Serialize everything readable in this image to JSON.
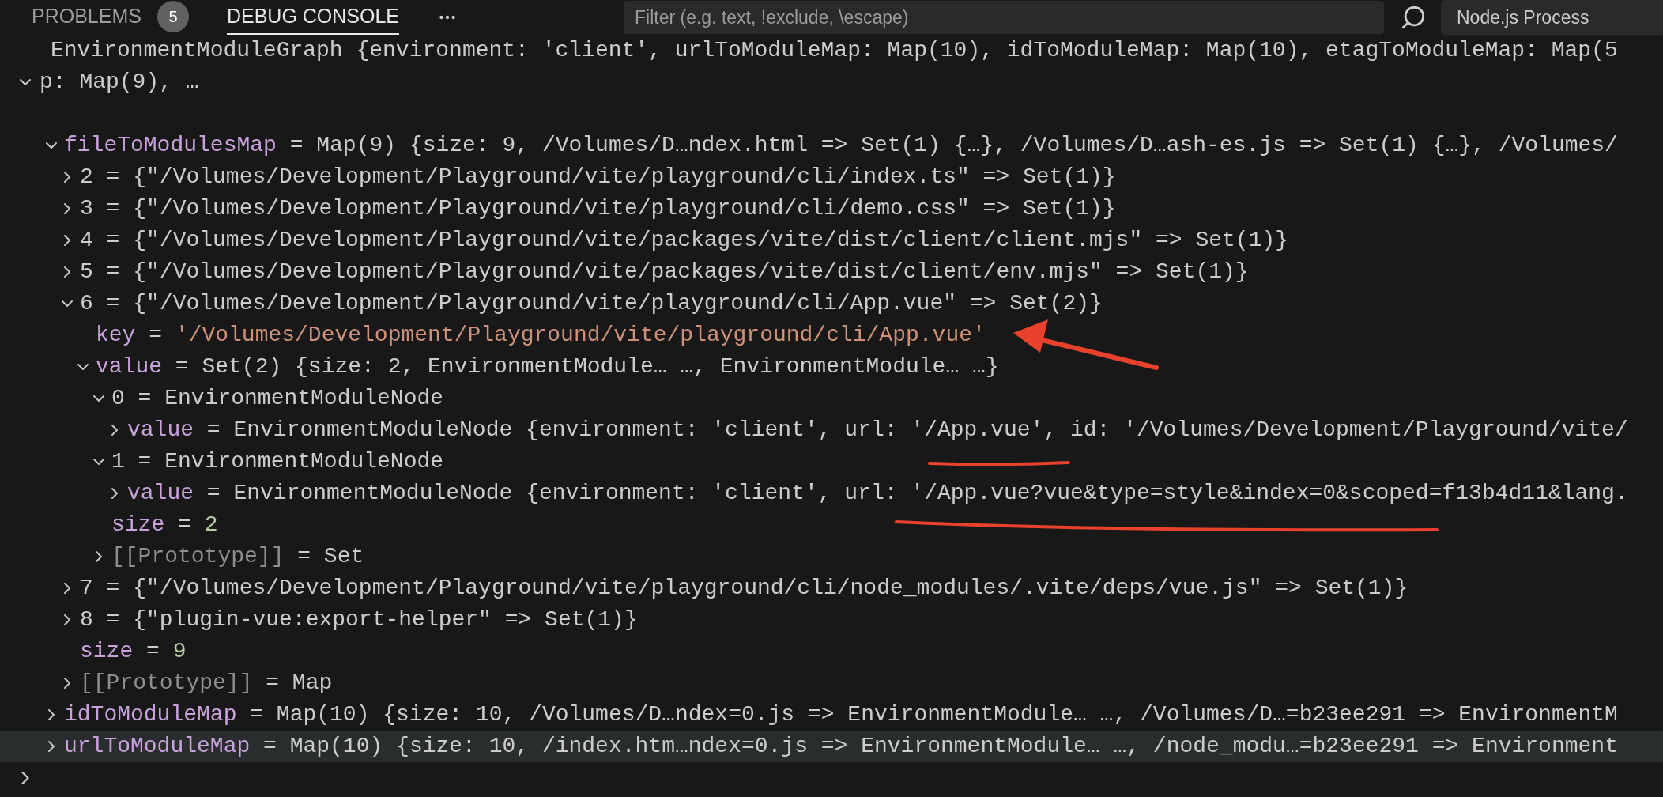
{
  "panel": {
    "tabs": [
      {
        "label": "PROBLEMS",
        "badge": "5",
        "selected": false
      },
      {
        "label": "DEBUG CONSOLE",
        "selected": true
      }
    ],
    "filter": {
      "placeholder": "Filter (e.g. text, !exclude, \\escape)"
    },
    "process_select": {
      "value": "Node.js Process"
    }
  },
  "console": {
    "root": {
      "lines": [
        "EnvironmentModuleGraph {environment: 'client', urlToModuleMap: Map(10), idToModuleMap: Map(10), etagToModuleMap: Map(5",
        "p: Map(9), …"
      ],
      "expanded": true,
      "children": [
        {
          "name": "fileToModulesMap",
          "separator": "=",
          "value": "Map(9) {size: 9, /Volumes/D…ndex.html => Set(1) {…}, /Volumes/D…ash-es.js => Set(1) {…}, /Volumes/",
          "kind": "property",
          "expandable": true,
          "expanded": true,
          "highlighted": false,
          "children": [
            {
              "name": "2",
              "separator": "=",
              "value": "{\"/Volumes/Development/Playground/vite/playground/cli/index.ts\" => Set(1)}",
              "kind": "index",
              "expandable": true,
              "expanded": false,
              "highlighted": false
            },
            {
              "name": "3",
              "separator": "=",
              "value": "{\"/Volumes/Development/Playground/vite/playground/cli/demo.css\" => Set(1)}",
              "kind": "index",
              "expandable": true,
              "expanded": false,
              "highlighted": false
            },
            {
              "name": "4",
              "separator": "=",
              "value": "{\"/Volumes/Development/Playground/vite/packages/vite/dist/client/client.mjs\" => Set(1)}",
              "kind": "index",
              "expandable": true,
              "expanded": false,
              "highlighted": false
            },
            {
              "name": "5",
              "separator": "=",
              "value": "{\"/Volumes/Development/Playground/vite/packages/vite/dist/client/env.mjs\" => Set(1)}",
              "kind": "index",
              "expandable": true,
              "expanded": false,
              "highlighted": false
            },
            {
              "name": "6",
              "separator": "=",
              "value": "{\"/Volumes/Development/Playground/vite/playground/cli/App.vue\" => Set(2)}",
              "kind": "index",
              "expandable": true,
              "expanded": true,
              "highlighted": false,
              "children": [
                {
                  "name": "key",
                  "separator": "=",
                  "value": "'/Volumes/Development/Playground/vite/playground/cli/App.vue'",
                  "kind": "string",
                  "expandable": false,
                  "highlighted": false
                },
                {
                  "name": "value",
                  "separator": "=",
                  "value": "Set(2) {size: 2, EnvironmentModule… …, EnvironmentModule… …}",
                  "kind": "property",
                  "expandable": true,
                  "expanded": true,
                  "highlighted": false,
                  "children": [
                    {
                      "name": "0",
                      "separator": "=",
                      "value": "EnvironmentModuleNode",
                      "kind": "index",
                      "expandable": true,
                      "expanded": true,
                      "highlighted": false,
                      "children": [
                        {
                          "name": "value",
                          "separator": "=",
                          "value": "EnvironmentModuleNode {environment: 'client', url: '/App.vue', id: '/Volumes/Development/Playground/vite/",
                          "kind": "property",
                          "expandable": true,
                          "expanded": false,
                          "highlighted": false
                        }
                      ]
                    },
                    {
                      "name": "1",
                      "separator": "=",
                      "value": "EnvironmentModuleNode",
                      "kind": "index",
                      "expandable": true,
                      "expanded": true,
                      "highlighted": false,
                      "children": [
                        {
                          "name": "value",
                          "separator": "=",
                          "value": "EnvironmentModuleNode {environment: 'client', url: '/App.vue?vue&type=style&index=0&scoped=f13b4d11&lang.",
                          "kind": "property",
                          "expandable": true,
                          "expanded": false,
                          "highlighted": false
                        }
                      ]
                    },
                    {
                      "name": "size",
                      "separator": "=",
                      "value": "2",
                      "kind": "number",
                      "expandable": false,
                      "highlighted": false
                    },
                    {
                      "name": "[[Prototype]]",
                      "separator": "=",
                      "value": "Set",
                      "kind": "internal",
                      "expandable": true,
                      "expanded": false,
                      "highlighted": false
                    }
                  ]
                }
              ]
            },
            {
              "name": "7",
              "separator": "=",
              "value": "{\"/Volumes/Development/Playground/vite/playground/cli/node_modules/.vite/deps/vue.js\" => Set(1)}",
              "kind": "index",
              "expandable": true,
              "expanded": false,
              "highlighted": false
            },
            {
              "name": "8",
              "separator": "=",
              "value": "{\"plugin-vue:export-helper\" => Set(1)}",
              "kind": "index",
              "expandable": true,
              "expanded": false,
              "highlighted": false
            },
            {
              "name": "size",
              "separator": "=",
              "value": "9",
              "kind": "number",
              "expandable": false,
              "highlighted": false
            },
            {
              "name": "[[Prototype]]",
              "separator": "=",
              "value": "Map",
              "kind": "internal",
              "expandable": true,
              "expanded": false,
              "highlighted": false
            }
          ]
        },
        {
          "name": "idToModuleMap",
          "separator": "=",
          "value": "Map(10) {size: 10, /Volumes/D…ndex=0.js => EnvironmentModule… …, /Volumes/D…=b23ee291 => EnvironmentM",
          "kind": "property",
          "expandable": true,
          "expanded": false,
          "highlighted": false
        },
        {
          "name": "urlToModuleMap",
          "separator": "=",
          "value": "Map(10) {size: 10, /index.htm…ndex=0.js => EnvironmentModule… …, /node_modu…=b23ee291 => Environment",
          "kind": "property",
          "expandable": true,
          "expanded": false,
          "highlighted": true
        }
      ]
    }
  }
}
